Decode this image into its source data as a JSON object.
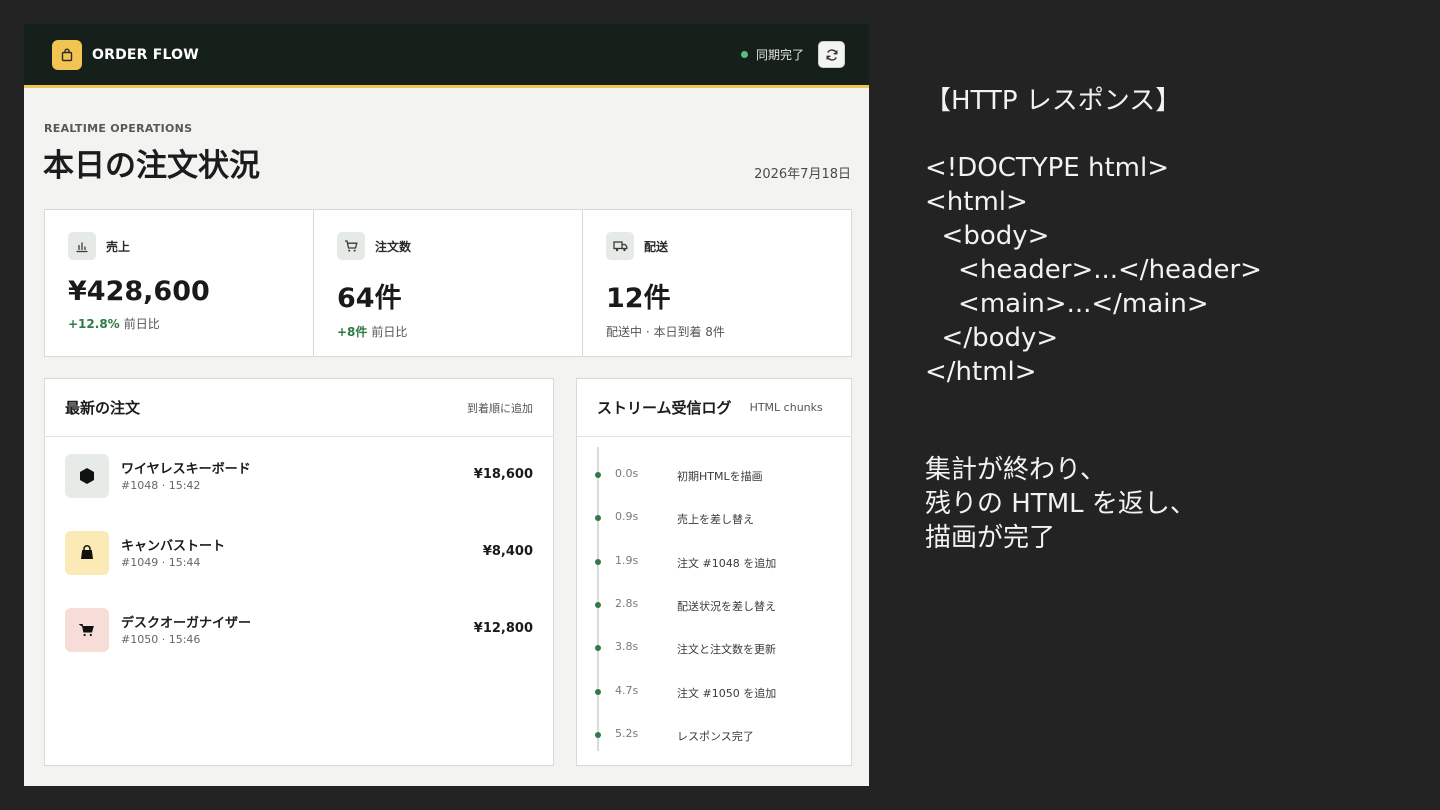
{
  "app": {
    "brand": "ORDER FLOW",
    "sync_status": "同期完了",
    "eyebrow": "REALTIME OPERATIONS",
    "title": "本日の注文状況",
    "date": "2026年7月18日",
    "colors": {
      "header_bg": "#16201a",
      "accent": "#f2c451",
      "positive": "#2f7a46"
    }
  },
  "kpis": [
    {
      "icon": "chart-icon",
      "label": "売上",
      "value": "¥428,600",
      "delta": "+12.8%",
      "sub": "前日比"
    },
    {
      "icon": "cart-icon",
      "label": "注文数",
      "value": "64件",
      "delta": "+8件",
      "sub": "前日比"
    },
    {
      "icon": "truck-icon",
      "label": "配送",
      "value": "12件",
      "delta": "",
      "sub": "配送中 · 本日到着 8件"
    }
  ],
  "orders": {
    "title": "最新の注文",
    "note": "到着順に追加",
    "items": [
      {
        "icon": "hexagon-icon",
        "name": "ワイヤレスキーボード",
        "meta": "#1048 · 15:42",
        "price": "¥18,600"
      },
      {
        "icon": "bag-icon",
        "name": "キャンバストート",
        "meta": "#1049 · 15:44",
        "price": "¥8,400"
      },
      {
        "icon": "cart-icon",
        "name": "デスクオーガナイザー",
        "meta": "#1050 · 15:46",
        "price": "¥12,800"
      }
    ]
  },
  "stream_log": {
    "title": "ストリーム受信ログ",
    "note": "HTML chunks",
    "entries": [
      {
        "time": "0.0s",
        "text": "初期HTMLを描画"
      },
      {
        "time": "0.9s",
        "text": "売上を差し替え"
      },
      {
        "time": "1.9s",
        "text": "注文 #1048 を追加"
      },
      {
        "time": "2.8s",
        "text": "配送状況を差し替え"
      },
      {
        "time": "3.8s",
        "text": "注文と注文数を更新"
      },
      {
        "time": "4.7s",
        "text": "注文 #1050 を追加"
      },
      {
        "time": "5.2s",
        "text": "レスポンス完了"
      }
    ]
  },
  "narration": {
    "heading": "【HTTP レスポンス】",
    "code": "<!DOCTYPE html>\n<html>\n  <body>\n    <header>...</header>\n    <main>...</main>\n  </body>\n</html>",
    "caption": "集計が終わり、\n残りの HTML を返し、\n描画が完了"
  }
}
